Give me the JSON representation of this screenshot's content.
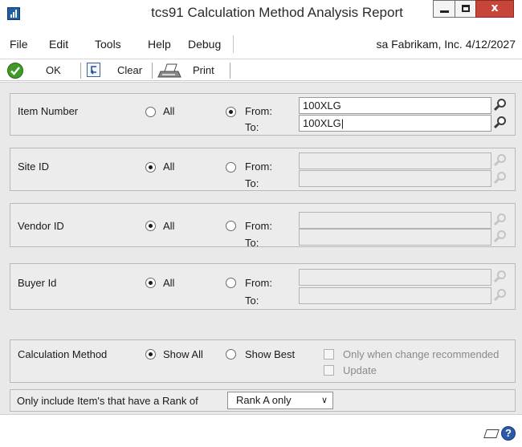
{
  "window": {
    "title": "tcs91 Calculation Method Analysis Report",
    "close_glyph": "x"
  },
  "menu": {
    "items": [
      "File",
      "Edit",
      "Tools",
      "Help",
      "Debug"
    ],
    "user_info": "sa  Fabrikam, Inc.  4/12/2027"
  },
  "toolbar": {
    "ok_label": "OK",
    "clear_label": "Clear",
    "print_label": "Print"
  },
  "ranges": [
    {
      "label": "Item Number",
      "all_label": "All",
      "from_label": "From:",
      "to_label": "To:",
      "selected": "from",
      "from_value": "100XLG",
      "to_value": "100XLG|",
      "enabled": true
    },
    {
      "label": "Site ID",
      "all_label": "All",
      "from_label": "From:",
      "to_label": "To:",
      "selected": "all",
      "from_value": "",
      "to_value": "",
      "enabled": false
    },
    {
      "label": "Vendor ID",
      "all_label": "All",
      "from_label": "From:",
      "to_label": "To:",
      "selected": "all",
      "from_value": "",
      "to_value": "",
      "enabled": false
    },
    {
      "label": "Buyer Id",
      "all_label": "All",
      "from_label": "From:",
      "to_label": "To:",
      "selected": "all",
      "from_value": "",
      "to_value": "",
      "enabled": false
    }
  ],
  "calculation": {
    "label": "Calculation Method",
    "show_all_label": "Show All",
    "show_best_label": "Show Best",
    "selected": "show_all",
    "only_when_label": "Only when change recommended",
    "update_label": "Update"
  },
  "rank_filter": {
    "label": "Only include Item's that have a Rank of",
    "selected": "Rank A only"
  },
  "colors": {
    "close_button": "#c7463a",
    "ok_icon": "#3f9a28",
    "help_icon": "#2a5aa8"
  }
}
